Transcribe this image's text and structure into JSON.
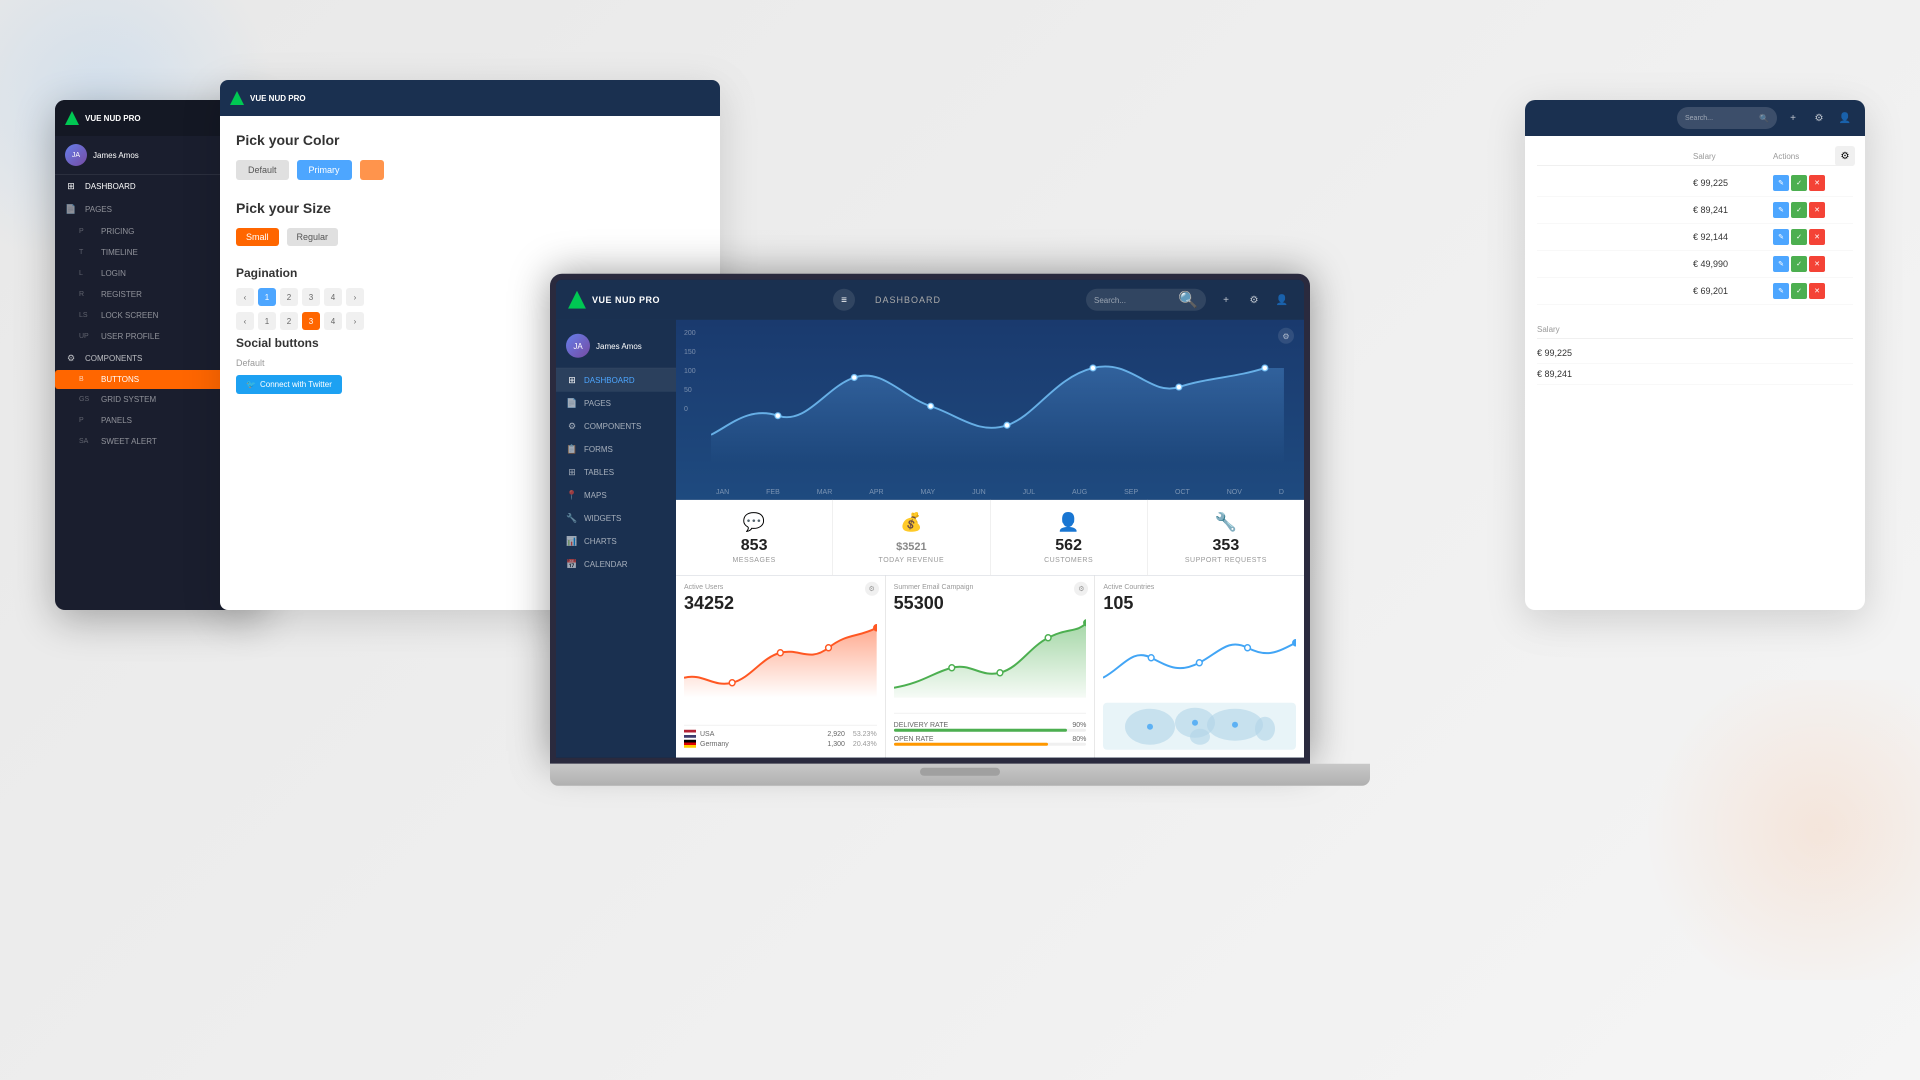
{
  "brand": {
    "name": "VUE NUD PRO",
    "logo_color": "#00c853"
  },
  "user": {
    "name": "James Amos"
  },
  "nav": {
    "page_title": "DASHBOARD",
    "search_placeholder": "Search..."
  },
  "sidebar": {
    "items": [
      {
        "prefix": "",
        "icon": "⊞",
        "label": "DASHBOARD",
        "active": true
      },
      {
        "prefix": "",
        "icon": "📄",
        "label": "PAGES",
        "active": false
      },
      {
        "prefix": "",
        "icon": "⚙",
        "label": "COMPONENTS",
        "active": false
      },
      {
        "prefix": "",
        "icon": "📋",
        "label": "FORMS",
        "active": false
      },
      {
        "prefix": "",
        "icon": "⊞",
        "label": "TABLES",
        "active": false
      },
      {
        "prefix": "",
        "icon": "📍",
        "label": "MAPS",
        "active": false
      },
      {
        "prefix": "",
        "icon": "🔧",
        "label": "WIDGETS",
        "active": false
      },
      {
        "prefix": "",
        "icon": "📊",
        "label": "CHARTS",
        "active": false
      },
      {
        "prefix": "",
        "icon": "📅",
        "label": "CALENDAR",
        "active": false
      }
    ]
  },
  "chart": {
    "y_labels": [
      "200",
      "150",
      "100",
      "50",
      "0"
    ],
    "months": [
      "JAN",
      "FEB",
      "MAR",
      "APR",
      "MAY",
      "JUN",
      "JUL",
      "AUG",
      "SEP",
      "OCT",
      "NOV",
      "D"
    ]
  },
  "stats": [
    {
      "icon": "💬",
      "icon_color": "#f06292",
      "value": "853",
      "prefix": "",
      "label": "MESSAGES"
    },
    {
      "icon": "💰",
      "icon_color": "#4caf50",
      "value": "3521",
      "prefix": "$",
      "label": "TODAY REVENUE"
    },
    {
      "icon": "👤",
      "icon_color": "#42a5f5",
      "value": "562",
      "prefix": "",
      "label": "CUSTOMERS"
    },
    {
      "icon": "🔧",
      "icon_color": "#ef5350",
      "value": "353",
      "prefix": "",
      "label": "SUPPORT REQUESTS"
    }
  ],
  "mini_charts": [
    {
      "title": "Active Users",
      "value": "34252",
      "type": "area",
      "color": "#ff5722",
      "data_rows": [
        {
          "flag": "us",
          "country": "USA",
          "value": "2,920",
          "percent": "53.23%"
        },
        {
          "flag": "de",
          "country": "Germany",
          "value": "1,300",
          "percent": "20.43%"
        }
      ]
    },
    {
      "title": "Summer Email Campaign",
      "value": "55300",
      "type": "area",
      "color": "#4caf50",
      "delivery_rate_label": "DELIVERY RATE",
      "delivery_rate_value": "90%",
      "open_rate_label": "OPEN RATE",
      "open_rate_value": "80%"
    },
    {
      "title": "Active Countries",
      "value": "105",
      "type": "line",
      "color": "#42a5f5"
    }
  ],
  "bg_left_sidebar": {
    "items": [
      {
        "label": "DASHBOARD",
        "active": true
      },
      {
        "prefix": "P",
        "label": "PRICING"
      },
      {
        "prefix": "T",
        "label": "TIMELINE"
      },
      {
        "prefix": "L",
        "label": "LOGIN"
      },
      {
        "prefix": "R",
        "label": "REGISTER"
      },
      {
        "prefix": "LS",
        "label": "LOCK SCREEN"
      },
      {
        "prefix": "UP",
        "label": "USER PROFILE"
      }
    ],
    "components_section": [
      {
        "prefix": "B",
        "label": "BUTTONS",
        "active": true
      },
      {
        "prefix": "GS",
        "label": "GRID SYSTEM"
      },
      {
        "prefix": "P",
        "label": "PANELS"
      },
      {
        "prefix": "SA",
        "label": "SWEET ALERT"
      }
    ]
  },
  "bg_center": {
    "color_section_title": "Pick your Color",
    "color_btns": [
      "Default",
      "Primary"
    ],
    "size_section_title": "Pick your Size",
    "size_btns": [
      "Small",
      "Regular"
    ],
    "pagination_title": "Pagination",
    "social_title": "Social buttons",
    "social_default": "Default",
    "twitter_btn": "Connect with Twitter"
  },
  "bg_right_table": {
    "salary_header": "Salary",
    "actions_header": "Actions",
    "rows": [
      {
        "salary": "€ 99,225"
      },
      {
        "salary": "€ 89,241"
      },
      {
        "salary": "€ 92,144"
      },
      {
        "salary": "€ 49,990"
      },
      {
        "salary": "€ 69,201"
      }
    ],
    "salary_header2": "Salary",
    "rows2": [
      {
        "salary": "€ 99,225"
      },
      {
        "salary": "€ 89,241"
      }
    ]
  }
}
